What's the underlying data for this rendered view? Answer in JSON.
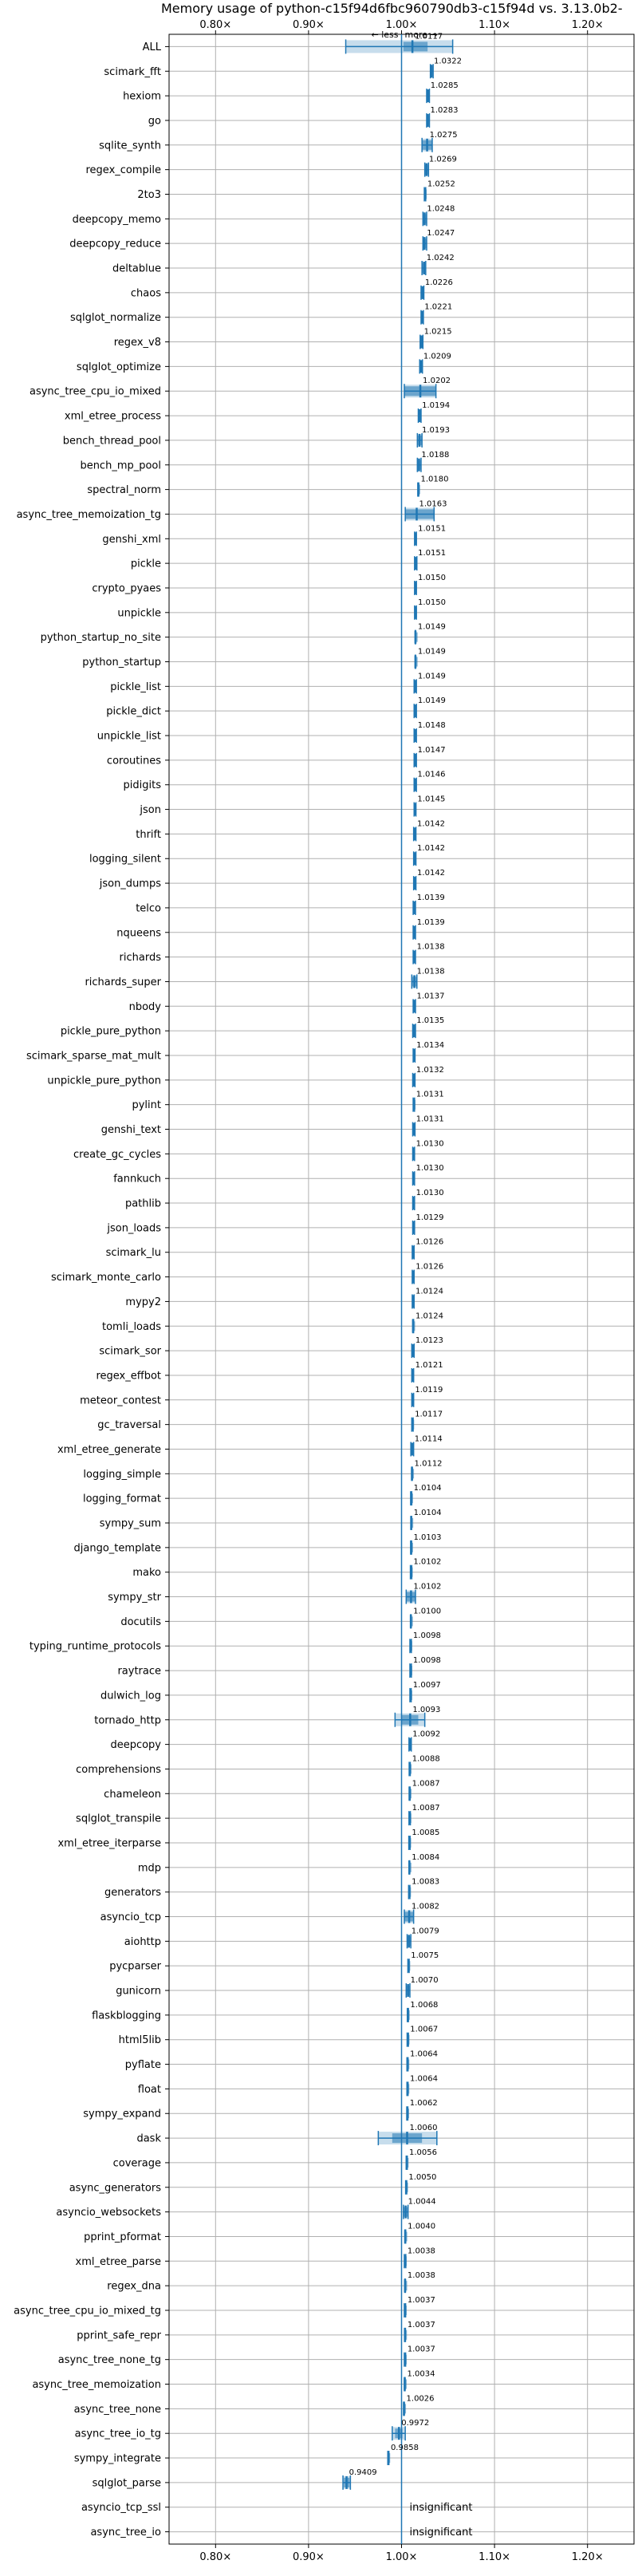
{
  "chart_data": {
    "type": "scatter",
    "title": "Memory usage of python-c15f94d6fbc960790db3-c15f94d vs. 3.13.0b2-",
    "direction_labels": {
      "less": "less",
      "more": "more"
    },
    "xlim": [
      0.75,
      1.25
    ],
    "x_ticks": [
      0.8,
      0.9,
      1.0,
      1.1,
      1.2
    ],
    "x_tick_labels": [
      "0.80×",
      "0.90×",
      "1.00×",
      "1.10×",
      "1.20×"
    ],
    "grid": true,
    "insignificant_text": "insignificant",
    "benchmarks": [
      {
        "name": "ALL",
        "value": 1.0117,
        "label": "1.0117",
        "low": 0.94,
        "high": 1.055,
        "box_low": 1.002,
        "box_high": 1.028
      },
      {
        "name": "scimark_fft",
        "value": 1.0322,
        "label": "1.0322",
        "low": 1.031,
        "high": 1.034
      },
      {
        "name": "hexiom",
        "value": 1.0285,
        "label": "1.0285",
        "low": 1.027,
        "high": 1.03
      },
      {
        "name": "go",
        "value": 1.0283,
        "label": "1.0283",
        "low": 1.027,
        "high": 1.03
      },
      {
        "name": "sqlite_synth",
        "value": 1.0275,
        "label": "1.0275",
        "low": 1.022,
        "high": 1.033
      },
      {
        "name": "regex_compile",
        "value": 1.0269,
        "label": "1.0269",
        "low": 1.025,
        "high": 1.029
      },
      {
        "name": "2to3",
        "value": 1.0252,
        "label": "1.0252",
        "low": 1.0245,
        "high": 1.026
      },
      {
        "name": "deepcopy_memo",
        "value": 1.0248,
        "label": "1.0248",
        "low": 1.023,
        "high": 1.027
      },
      {
        "name": "deepcopy_reduce",
        "value": 1.0247,
        "label": "1.0247",
        "low": 1.023,
        "high": 1.027
      },
      {
        "name": "deltablue",
        "value": 1.0242,
        "label": "1.0242",
        "low": 1.022,
        "high": 1.026
      },
      {
        "name": "chaos",
        "value": 1.0226,
        "label": "1.0226",
        "low": 1.021,
        "high": 1.024
      },
      {
        "name": "sqlglot_normalize",
        "value": 1.0221,
        "label": "1.0221",
        "low": 1.021,
        "high": 1.0235
      },
      {
        "name": "regex_v8",
        "value": 1.0215,
        "label": "1.0215",
        "low": 1.02,
        "high": 1.023
      },
      {
        "name": "sqlglot_optimize",
        "value": 1.0209,
        "label": "1.0209",
        "low": 1.0195,
        "high": 1.0225
      },
      {
        "name": "async_tree_cpu_io_mixed",
        "value": 1.0202,
        "label": "1.0202",
        "low": 1.003,
        "high": 1.037
      },
      {
        "name": "xml_etree_process",
        "value": 1.0194,
        "label": "1.0194",
        "low": 1.018,
        "high": 1.021
      },
      {
        "name": "bench_thread_pool",
        "value": 1.0193,
        "label": "1.0193",
        "low": 1.017,
        "high": 1.022
      },
      {
        "name": "bench_mp_pool",
        "value": 1.0188,
        "label": "1.0188",
        "low": 1.017,
        "high": 1.021
      },
      {
        "name": "spectral_norm",
        "value": 1.018,
        "label": "1.0180",
        "low": 1.0175,
        "high": 1.0185
      },
      {
        "name": "async_tree_memoization_tg",
        "value": 1.0163,
        "label": "1.0163",
        "low": 1.004,
        "high": 1.035
      },
      {
        "name": "genshi_xml",
        "value": 1.0151,
        "label": "1.0151",
        "low": 1.014,
        "high": 1.016
      },
      {
        "name": "pickle",
        "value": 1.0151,
        "label": "1.0151",
        "low": 1.014,
        "high": 1.0165
      },
      {
        "name": "crypto_pyaes",
        "value": 1.015,
        "label": "1.0150",
        "low": 1.014,
        "high": 1.016
      },
      {
        "name": "unpickle",
        "value": 1.015,
        "label": "1.0150",
        "low": 1.014,
        "high": 1.016
      },
      {
        "name": "python_startup_no_site",
        "value": 1.0149,
        "label": "1.0149",
        "low": 1.0147,
        "high": 1.0151
      },
      {
        "name": "python_startup",
        "value": 1.0149,
        "label": "1.0149",
        "low": 1.0147,
        "high": 1.0151
      },
      {
        "name": "pickle_list",
        "value": 1.0149,
        "label": "1.0149",
        "low": 1.0135,
        "high": 1.016
      },
      {
        "name": "pickle_dict",
        "value": 1.0149,
        "label": "1.0149",
        "low": 1.0135,
        "high": 1.016
      },
      {
        "name": "unpickle_list",
        "value": 1.0148,
        "label": "1.0148",
        "low": 1.0135,
        "high": 1.016
      },
      {
        "name": "coroutines",
        "value": 1.0147,
        "label": "1.0147",
        "low": 1.0135,
        "high": 1.016
      },
      {
        "name": "pidigits",
        "value": 1.0146,
        "label": "1.0146",
        "low": 1.0135,
        "high": 1.016
      },
      {
        "name": "json",
        "value": 1.0145,
        "label": "1.0145",
        "low": 1.0135,
        "high": 1.0155
      },
      {
        "name": "thrift",
        "value": 1.0142,
        "label": "1.0142",
        "low": 1.013,
        "high": 1.0155
      },
      {
        "name": "logging_silent",
        "value": 1.0142,
        "label": "1.0142",
        "low": 1.013,
        "high": 1.0155
      },
      {
        "name": "json_dumps",
        "value": 1.0142,
        "label": "1.0142",
        "low": 1.013,
        "high": 1.0155
      },
      {
        "name": "telco",
        "value": 1.0139,
        "label": "1.0139",
        "low": 1.0125,
        "high": 1.015
      },
      {
        "name": "nqueens",
        "value": 1.0139,
        "label": "1.0139",
        "low": 1.0125,
        "high": 1.015
      },
      {
        "name": "richards",
        "value": 1.0138,
        "label": "1.0138",
        "low": 1.0125,
        "high": 1.015
      },
      {
        "name": "richards_super",
        "value": 1.0138,
        "label": "1.0138",
        "low": 1.011,
        "high": 1.0165
      },
      {
        "name": "nbody",
        "value": 1.0137,
        "label": "1.0137",
        "low": 1.0125,
        "high": 1.015
      },
      {
        "name": "pickle_pure_python",
        "value": 1.0135,
        "label": "1.0135",
        "low": 1.012,
        "high": 1.015
      },
      {
        "name": "scimark_sparse_mat_mult",
        "value": 1.0134,
        "label": "1.0134",
        "low": 1.0125,
        "high": 1.0145
      },
      {
        "name": "unpickle_pure_python",
        "value": 1.0132,
        "label": "1.0132",
        "low": 1.012,
        "high": 1.0145
      },
      {
        "name": "pylint",
        "value": 1.0131,
        "label": "1.0131",
        "low": 1.0125,
        "high": 1.014
      },
      {
        "name": "genshi_text",
        "value": 1.0131,
        "label": "1.0131",
        "low": 1.012,
        "high": 1.0145
      },
      {
        "name": "create_gc_cycles",
        "value": 1.013,
        "label": "1.0130",
        "low": 1.012,
        "high": 1.014
      },
      {
        "name": "fannkuch",
        "value": 1.013,
        "label": "1.0130",
        "low": 1.012,
        "high": 1.014
      },
      {
        "name": "pathlib",
        "value": 1.013,
        "label": "1.0130",
        "low": 1.012,
        "high": 1.014
      },
      {
        "name": "json_loads",
        "value": 1.0129,
        "label": "1.0129",
        "low": 1.012,
        "high": 1.014
      },
      {
        "name": "scimark_lu",
        "value": 1.0126,
        "label": "1.0126",
        "low": 1.0115,
        "high": 1.0135
      },
      {
        "name": "scimark_monte_carlo",
        "value": 1.0126,
        "label": "1.0126",
        "low": 1.0115,
        "high": 1.0135
      },
      {
        "name": "mypy2",
        "value": 1.0124,
        "label": "1.0124",
        "low": 1.0115,
        "high": 1.0135
      },
      {
        "name": "tomli_loads",
        "value": 1.0124,
        "label": "1.0124",
        "low": 1.012,
        "high": 1.013
      },
      {
        "name": "scimark_sor",
        "value": 1.0123,
        "label": "1.0123",
        "low": 1.011,
        "high": 1.0135
      },
      {
        "name": "regex_effbot",
        "value": 1.0121,
        "label": "1.0121",
        "low": 1.011,
        "high": 1.013
      },
      {
        "name": "meteor_contest",
        "value": 1.0119,
        "label": "1.0119",
        "low": 1.011,
        "high": 1.013
      },
      {
        "name": "gc_traversal",
        "value": 1.0117,
        "label": "1.0117",
        "low": 1.011,
        "high": 1.0125
      },
      {
        "name": "xml_etree_generate",
        "value": 1.0114,
        "label": "1.0114",
        "low": 1.01,
        "high": 1.013
      },
      {
        "name": "logging_simple",
        "value": 1.0112,
        "label": "1.0112",
        "low": 1.0108,
        "high": 1.0116
      },
      {
        "name": "logging_format",
        "value": 1.0104,
        "label": "1.0104",
        "low": 1.0098,
        "high": 1.011
      },
      {
        "name": "sympy_sum",
        "value": 1.0104,
        "label": "1.0104",
        "low": 1.01,
        "high": 1.0108
      },
      {
        "name": "django_template",
        "value": 1.0103,
        "label": "1.0103",
        "low": 1.0098,
        "high": 1.0108
      },
      {
        "name": "mako",
        "value": 1.0102,
        "label": "1.0102",
        "low": 1.0095,
        "high": 1.011
      },
      {
        "name": "sympy_str",
        "value": 1.0102,
        "label": "1.0102",
        "low": 1.005,
        "high": 1.015
      },
      {
        "name": "docutils",
        "value": 1.01,
        "label": "1.0100",
        "low": 1.0096,
        "high": 1.0104
      },
      {
        "name": "typing_runtime_protocols",
        "value": 1.0098,
        "label": "1.0098",
        "low": 1.009,
        "high": 1.0106
      },
      {
        "name": "raytrace",
        "value": 1.0098,
        "label": "1.0098",
        "low": 1.009,
        "high": 1.0106
      },
      {
        "name": "dulwich_log",
        "value": 1.0097,
        "label": "1.0097",
        "low": 1.009,
        "high": 1.0104
      },
      {
        "name": "tornado_http",
        "value": 1.0093,
        "label": "1.0093",
        "low": 0.993,
        "high": 1.025,
        "box_low": 1.0,
        "box_high": 1.018
      },
      {
        "name": "deepcopy",
        "value": 1.0092,
        "label": "1.0092",
        "low": 1.008,
        "high": 1.0105
      },
      {
        "name": "comprehensions",
        "value": 1.0088,
        "label": "1.0088",
        "low": 1.0082,
        "high": 1.0094
      },
      {
        "name": "chameleon",
        "value": 1.0087,
        "label": "1.0087",
        "low": 1.0082,
        "high": 1.0092
      },
      {
        "name": "sqlglot_transpile",
        "value": 1.0087,
        "label": "1.0087",
        "low": 1.008,
        "high": 1.0095
      },
      {
        "name": "xml_etree_iterparse",
        "value": 1.0085,
        "label": "1.0085",
        "low": 1.0078,
        "high": 1.0092
      },
      {
        "name": "mdp",
        "value": 1.0084,
        "label": "1.0084",
        "low": 1.008,
        "high": 1.0088
      },
      {
        "name": "generators",
        "value": 1.0083,
        "label": "1.0083",
        "low": 1.0076,
        "high": 1.009
      },
      {
        "name": "asyncio_tcp",
        "value": 1.0082,
        "label": "1.0082",
        "low": 1.003,
        "high": 1.013
      },
      {
        "name": "aiohttp",
        "value": 1.0079,
        "label": "1.0079",
        "low": 1.006,
        "high": 1.01
      },
      {
        "name": "pycparser",
        "value": 1.0075,
        "label": "1.0075",
        "low": 1.0068,
        "high": 1.0082
      },
      {
        "name": "gunicorn",
        "value": 1.007,
        "label": "1.0070",
        "low": 1.005,
        "high": 1.009
      },
      {
        "name": "flaskblogging",
        "value": 1.0068,
        "label": "1.0068",
        "low": 1.0062,
        "high": 1.0074
      },
      {
        "name": "html5lib",
        "value": 1.0067,
        "label": "1.0067",
        "low": 1.006,
        "high": 1.0074
      },
      {
        "name": "pyflate",
        "value": 1.0064,
        "label": "1.0064",
        "low": 1.0058,
        "high": 1.007
      },
      {
        "name": "float",
        "value": 1.0064,
        "label": "1.0064",
        "low": 1.0058,
        "high": 1.007
      },
      {
        "name": "sympy_expand",
        "value": 1.0062,
        "label": "1.0062",
        "low": 1.0056,
        "high": 1.0068
      },
      {
        "name": "dask",
        "value": 1.006,
        "label": "1.0060",
        "low": 0.975,
        "high": 1.038,
        "box_low": 0.99,
        "box_high": 1.022
      },
      {
        "name": "coverage",
        "value": 1.0056,
        "label": "1.0056",
        "low": 1.005,
        "high": 1.0062
      },
      {
        "name": "async_generators",
        "value": 1.005,
        "label": "1.0050",
        "low": 1.0044,
        "high": 1.0056
      },
      {
        "name": "asyncio_websockets",
        "value": 1.0044,
        "label": "1.0044",
        "low": 1.002,
        "high": 1.007
      },
      {
        "name": "pprint_pformat",
        "value": 1.004,
        "label": "1.0040",
        "low": 1.0035,
        "high": 1.0045
      },
      {
        "name": "xml_etree_parse",
        "value": 1.0038,
        "label": "1.0038",
        "low": 1.003,
        "high": 1.0046
      },
      {
        "name": "regex_dna",
        "value": 1.0038,
        "label": "1.0038",
        "low": 1.0034,
        "high": 1.0042
      },
      {
        "name": "async_tree_cpu_io_mixed_tg",
        "value": 1.0037,
        "label": "1.0037",
        "low": 1.003,
        "high": 1.0044
      },
      {
        "name": "pprint_safe_repr",
        "value": 1.0037,
        "label": "1.0037",
        "low": 1.0032,
        "high": 1.0042
      },
      {
        "name": "async_tree_none_tg",
        "value": 1.0037,
        "label": "1.0037",
        "low": 1.003,
        "high": 1.0044
      },
      {
        "name": "async_tree_memoization",
        "value": 1.0034,
        "label": "1.0034",
        "low": 1.003,
        "high": 1.0038
      },
      {
        "name": "async_tree_none",
        "value": 1.0026,
        "label": "1.0026",
        "low": 1.0022,
        "high": 1.003
      },
      {
        "name": "async_tree_io_tg",
        "value": 0.9972,
        "label": "0.9972",
        "low": 0.99,
        "high": 1.004,
        "box_low": 0.993,
        "box_high": 1.001
      },
      {
        "name": "sympy_integrate",
        "value": 0.9858,
        "label": "0.9858",
        "low": 0.9852,
        "high": 0.9864
      },
      {
        "name": "sqlglot_parse",
        "value": 0.9409,
        "label": "0.9409",
        "low": 0.937,
        "high": 0.945,
        "box_low": 0.938,
        "box_high": 0.944
      },
      {
        "name": "asyncio_tcp_ssl",
        "value": null,
        "label": "",
        "insignificant": true
      },
      {
        "name": "async_tree_io",
        "value": null,
        "label": "",
        "insignificant": true
      }
    ]
  }
}
